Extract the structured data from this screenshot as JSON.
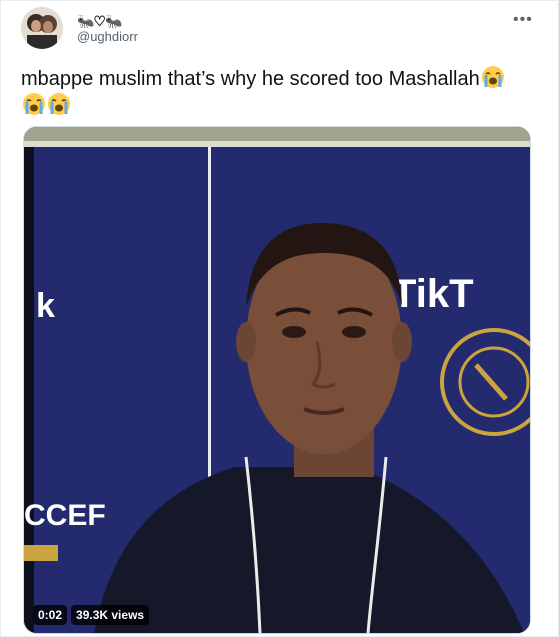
{
  "author": {
    "display_name": "🐜♡🐜",
    "handle": "@ughdiorr"
  },
  "tweet": {
    "text": "mbappe muslim that’s why he scored too Mashallah"
  },
  "media": {
    "backdrop_logo_text": "TikT",
    "backdrop_left_text": "k",
    "backdrop_bottom_text": "CCEF",
    "duration": "0:02",
    "views": "39.3K views"
  },
  "icons": {
    "emoji": "loudly-crying-face",
    "more": "ellipsis-icon"
  },
  "colors": {
    "backdrop": "#232a6e",
    "gold": "#c9a441"
  }
}
